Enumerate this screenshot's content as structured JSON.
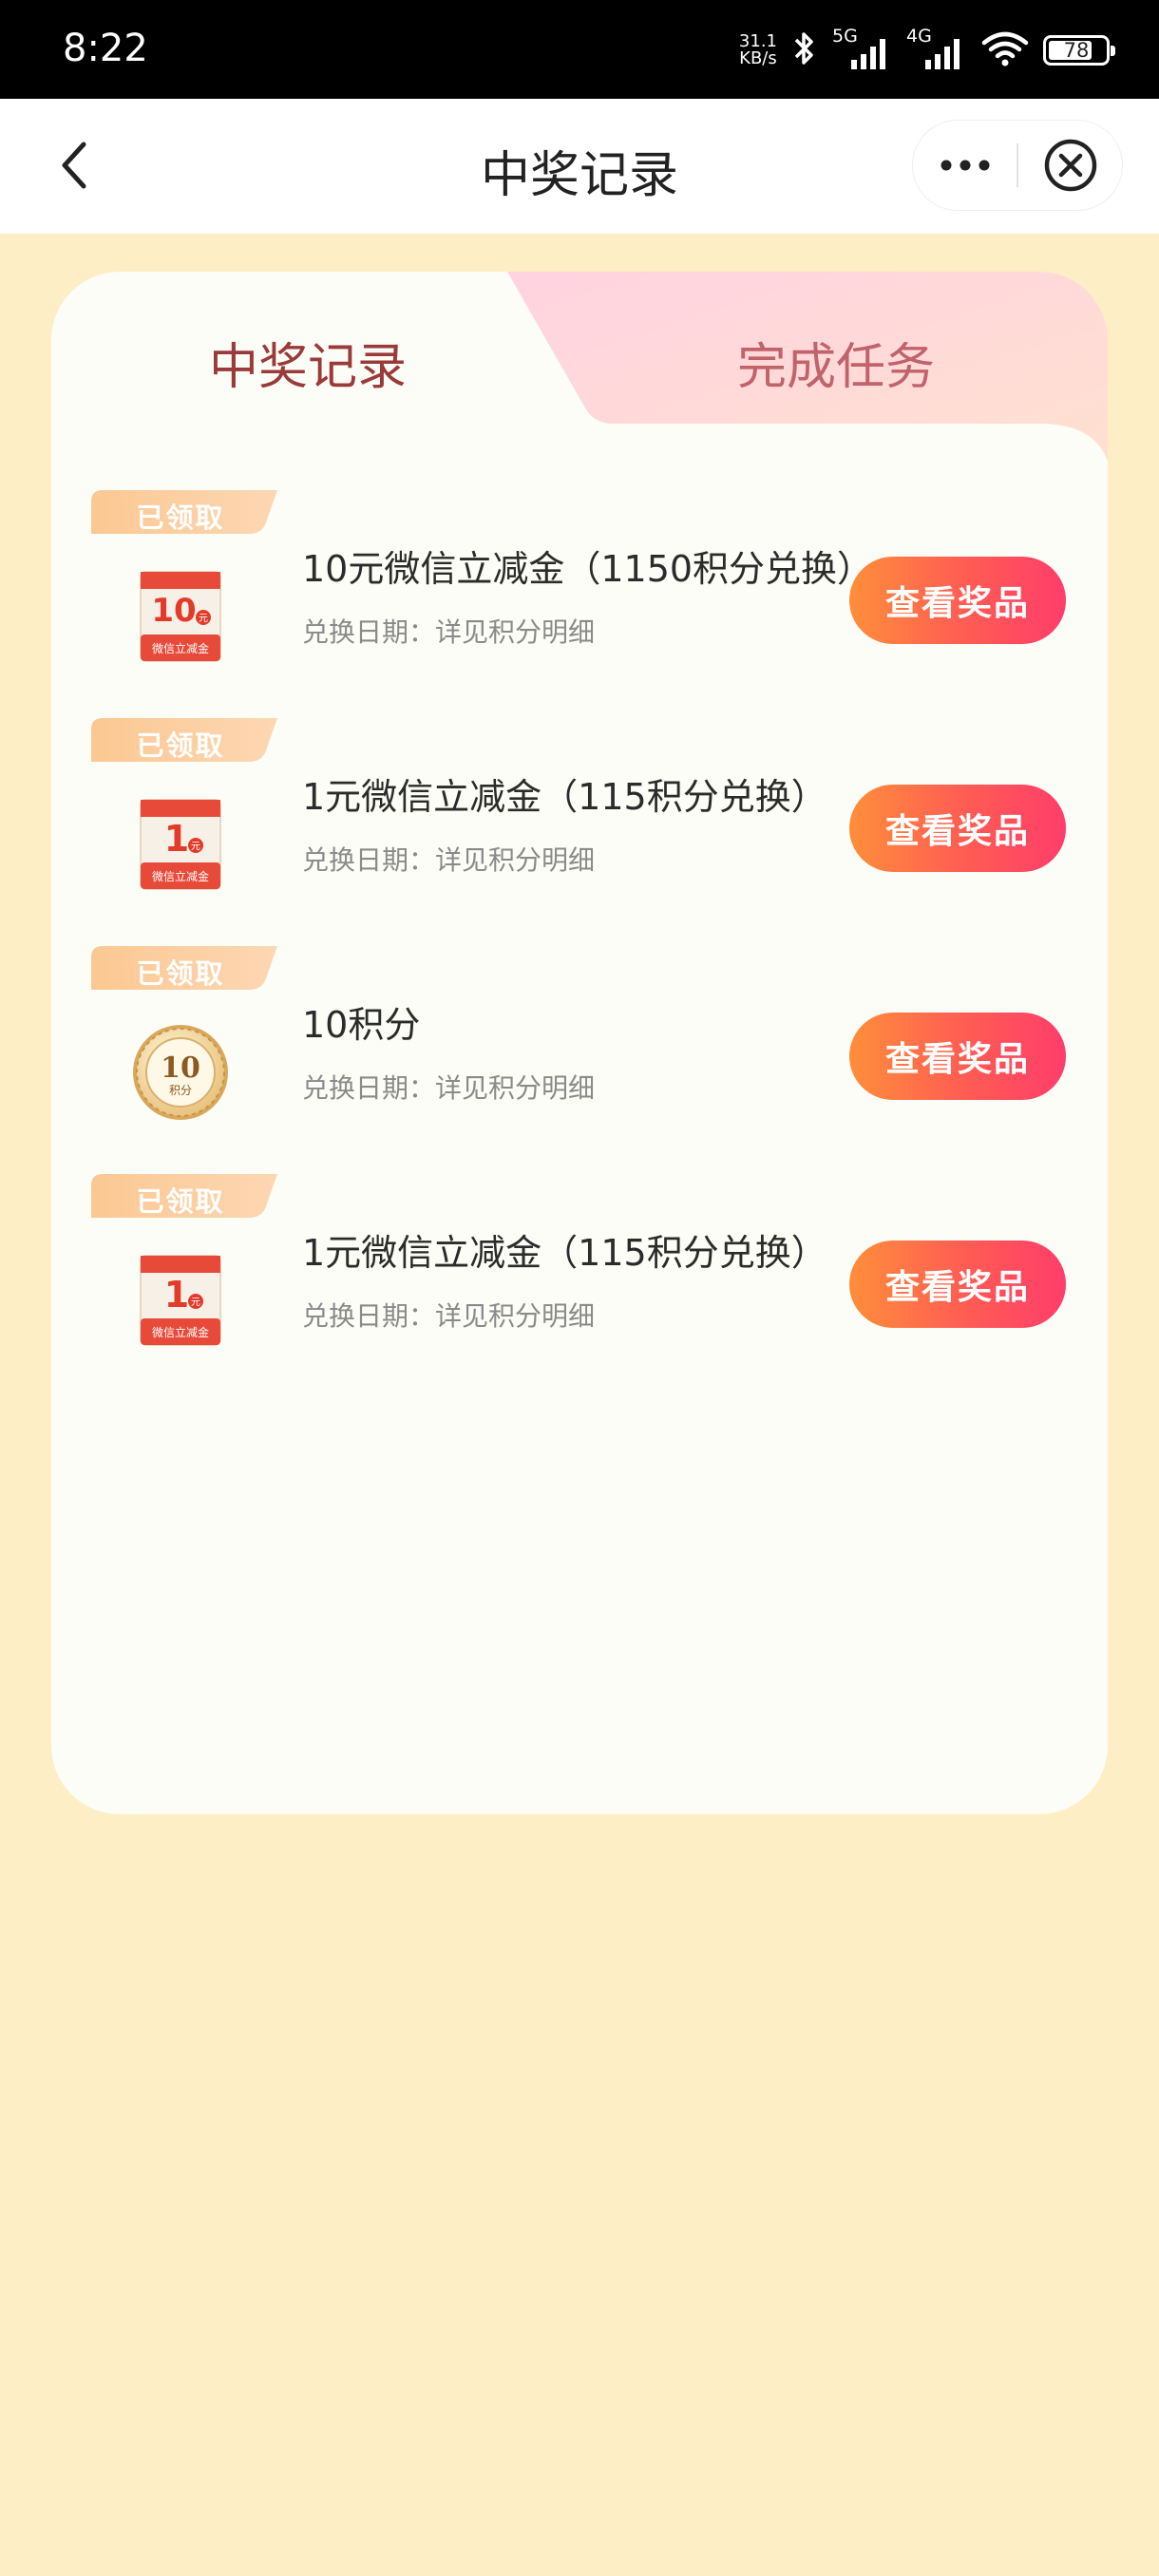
{
  "status_bar": {
    "time": "8:22",
    "net_speed_value": "31.1",
    "net_speed_unit": "KB/s",
    "signal_1_label": "5G",
    "signal_2_label": "4G",
    "battery": "78",
    "battery_level": 0.78
  },
  "nav": {
    "title": "中奖记录"
  },
  "tabs": {
    "records": "中奖记录",
    "tasks": "完成任务"
  },
  "prizes": [
    {
      "tag": "已领取",
      "icon_value": "10",
      "icon_unit": "元",
      "icon_caption": "微信立减金",
      "title": "10元微信立减金（1150积分兑换）",
      "date": "兑换日期：详见积分明细",
      "button": "查看奖品"
    },
    {
      "tag": "已领取",
      "icon_value": "1",
      "icon_unit": "元",
      "icon_caption": "微信立减金",
      "title": "1元微信立减金（115积分兑换）",
      "date": "兑换日期：详见积分明细",
      "button": "查看奖品"
    },
    {
      "tag": "已领取",
      "icon_value": "10",
      "icon_caption": "积分",
      "title": "10积分",
      "date": "兑换日期：详见积分明细",
      "button": "查看奖品"
    },
    {
      "tag": "已领取",
      "icon_value": "1",
      "icon_unit": "元",
      "icon_caption": "微信立减金",
      "title": "1元微信立减金（115积分兑换）",
      "date": "兑换日期：详见积分明细",
      "button": "查看奖品"
    }
  ]
}
